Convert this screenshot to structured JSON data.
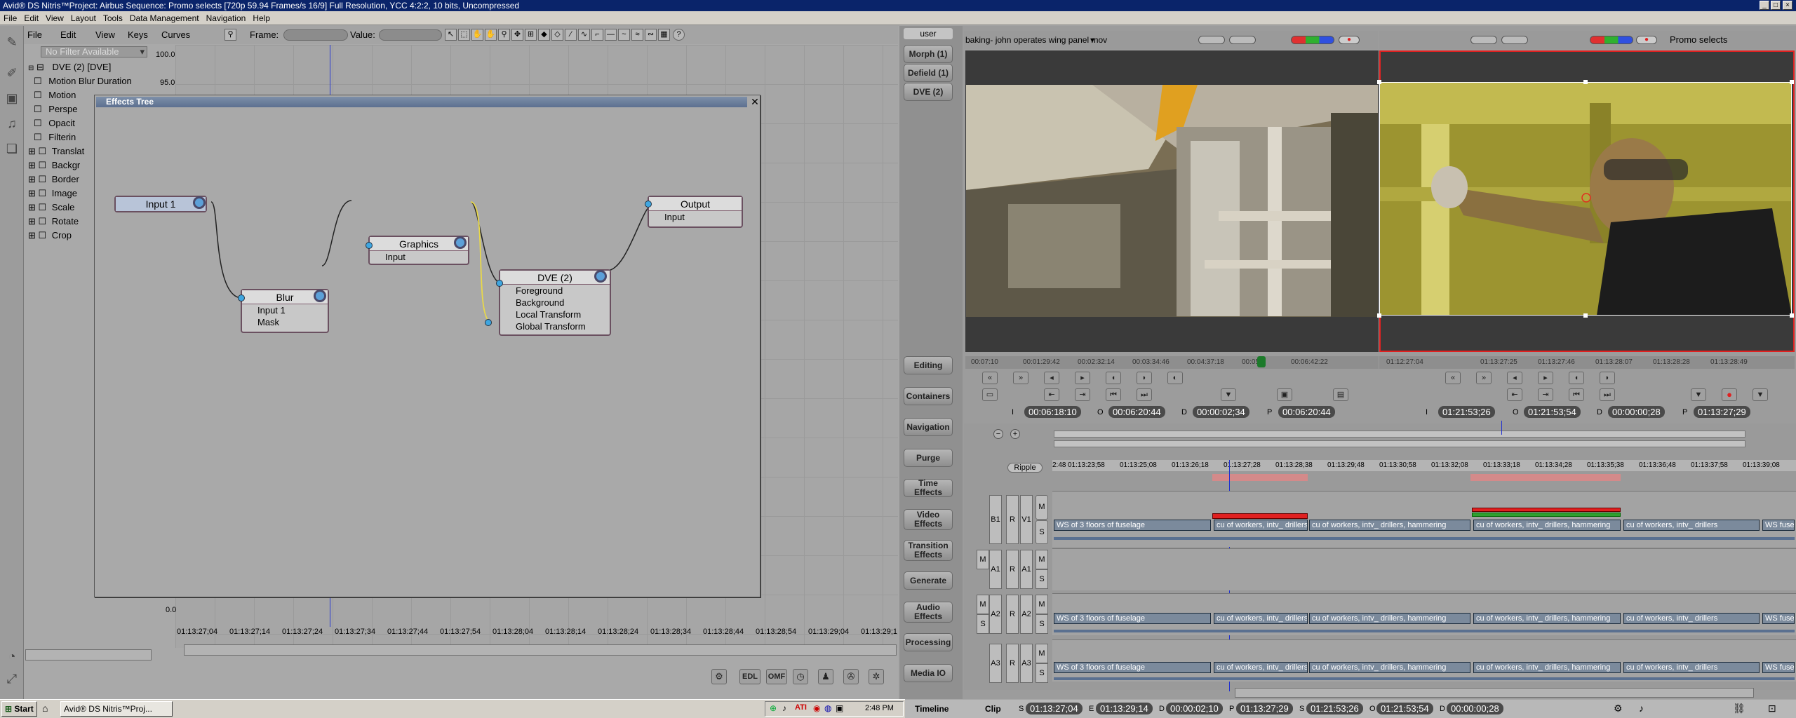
{
  "window": {
    "title": "Avid® DS Nitris™Project: Airbus     Sequence: Promo selects     [720p 59.94 Frames/s 16/9]   Full Resolution, YCC 4:2:2, 10 bits, Uncompressed"
  },
  "menu": [
    "File",
    "Edit",
    "View",
    "Layout",
    "Tools",
    "Data Management",
    "Navigation",
    "Help"
  ],
  "editor_toolbar": {
    "menus": [
      "File",
      "Edit",
      "View",
      "Keys",
      "Curves"
    ],
    "frame_label": "Frame:",
    "value_label": "Value:"
  },
  "filter": {
    "label": "No Filter Available"
  },
  "tree": {
    "root": "DVE (2) [DVE]",
    "items": [
      "Motion Blur Duration",
      "Motion",
      "Perspe",
      "Opacit",
      "Filterin",
      "Translat",
      "Backgr",
      "Border",
      "Image",
      "Scale",
      "Rotate",
      "Crop"
    ]
  },
  "graph_axis": {
    "y_top": "100.0",
    "y_second": "95.0",
    "y_bottom": "0.0"
  },
  "graph_ruler": [
    "01:13:27;04",
    "01:13:27;14",
    "01:13:27;24",
    "01:13:27;34",
    "01:13:27;44",
    "01:13:27;54",
    "01:13:28;04",
    "01:13:28;14",
    "01:13:28;24",
    "01:13:28;34",
    "01:13:28;44",
    "01:13:28;54",
    "01:13:29;04",
    "01:13:29;1"
  ],
  "effects_tree": {
    "title": "Effects Tree",
    "nodes": {
      "input1": {
        "title": "Input 1"
      },
      "blur": {
        "title": "Blur",
        "ports": [
          "Input 1",
          "Mask"
        ]
      },
      "graphics": {
        "title": "Graphics",
        "ports": [
          "Input"
        ]
      },
      "dve": {
        "title": "DVE (2)",
        "ports": [
          "Foreground",
          "Background",
          "Local Transform",
          "Global Transform"
        ]
      },
      "output": {
        "title": "Output",
        "ports": [
          "Input"
        ]
      }
    }
  },
  "side_panel": {
    "user_tab": "user",
    "top_buttons": [
      "Morph (1)",
      "Defield (1)",
      "DVE (2)"
    ],
    "buttons": [
      "Editing",
      "Containers",
      "Navigation",
      "Purge",
      "Time Effects",
      "Video Effects",
      "Transition Effects",
      "Generate",
      "Audio Effects",
      "Processing",
      "Media IO"
    ]
  },
  "source_viewer": {
    "clip_name": "baking- john operates wing panel mov",
    "ruler": [
      "00:07:10",
      "00:01:29:42",
      "00:02:32:14",
      "00:03:34:46",
      "00:04:37:18",
      "00:05:",
      "00:06:42:22"
    ],
    "in_label": "I",
    "in_tc": "00:06:18:10",
    "out_label": "O",
    "out_tc": "00:06:20:44",
    "dur_label": "D",
    "dur_tc": "00:00:02;34",
    "pos_label": "P",
    "pos_tc": "00:06:20:44"
  },
  "record_viewer": {
    "sequence_name": "Promo selects",
    "ruler": [
      "01:12:27:04",
      "01:13:27:25",
      "01:13:27:46",
      "01:13:28:07",
      "01:13:28:28",
      "01:13:28:49"
    ],
    "in_label": "I",
    "in_tc": "01:21:53;26",
    "out_label": "O",
    "out_tc": "01:21:53;54",
    "dur_label": "D",
    "dur_tc": "00:00:00;28",
    "pos_label": "P",
    "pos_tc": "01:13:27;29"
  },
  "timeline": {
    "ripple_label": "Ripple",
    "ruler": [
      "2:48",
      "01:13:23;58",
      "01:13:25;08",
      "01:13:26;18",
      "01:13:27;28",
      "01:13:28;38",
      "01:13:29;48",
      "01:13:30;58",
      "01:13:32;08",
      "01:13:33;18",
      "01:13:34;28",
      "01:13:35;38",
      "01:13:36;48",
      "01:13:37;58",
      "01:13:39;08"
    ],
    "tracks": [
      {
        "name": "V1",
        "src": "B1",
        "clips": [
          "WS of 3 floors of fuselage",
          "cu of workers, intv_ drillers",
          "cu of workers, intv_ drillers, hammering",
          "cu of workers, intv_ drillers, hammering",
          "cu of workers, intv_ drillers",
          "WS fuse"
        ]
      },
      {
        "name": "A1",
        "src": "A1",
        "clips": []
      },
      {
        "name": "A2",
        "src": "A2",
        "clips": [
          "WS of 3 floors of fuselage",
          "cu of workers, intv_ drillers",
          "cu of workers, intv_ drillers, hammering",
          "cu of workers, intv_ drillers, hammering",
          "cu of workers, intv_ drillers",
          "WS fuse"
        ]
      },
      {
        "name": "A3",
        "src": "A3",
        "clips": [
          "WS of 3 floors of fuselage",
          "cu of workers, intv_ drillers",
          "cu of workers, intv_ drillers, hammering",
          "cu of workers, intv_ drillers, hammering",
          "cu of workers, intv_ drillers",
          "WS fuse"
        ]
      }
    ],
    "track_letters": {
      "record": "R",
      "mute": "M",
      "solo": "S"
    }
  },
  "bottom_status": {
    "tab_timeline": "Timeline",
    "tab_clip": "Clip",
    "s_label": "S",
    "s_tc": "01:13:27;04",
    "e_label": "E",
    "e_tc": "01:13:29;14",
    "d_label": "D",
    "d_tc": "00:00:02;10",
    "p_label": "P",
    "p_tc": "01:13:27;29",
    "s2_label": "S",
    "s2_tc": "01:21:53;26",
    "o_label": "O",
    "o_tc": "01:21:53;54",
    "d2_label": "D",
    "d2_tc": "00:00:00;28"
  },
  "bottom_tools": [
    "EDL",
    "OMF"
  ],
  "taskbar": {
    "start": "Start",
    "task": "Avid® DS Nitris™Proj...",
    "clock": "2:48 PM"
  },
  "colors": {
    "accent": "#0a246a",
    "record_border": "#e02020",
    "node_port": "#3fa6e0"
  }
}
